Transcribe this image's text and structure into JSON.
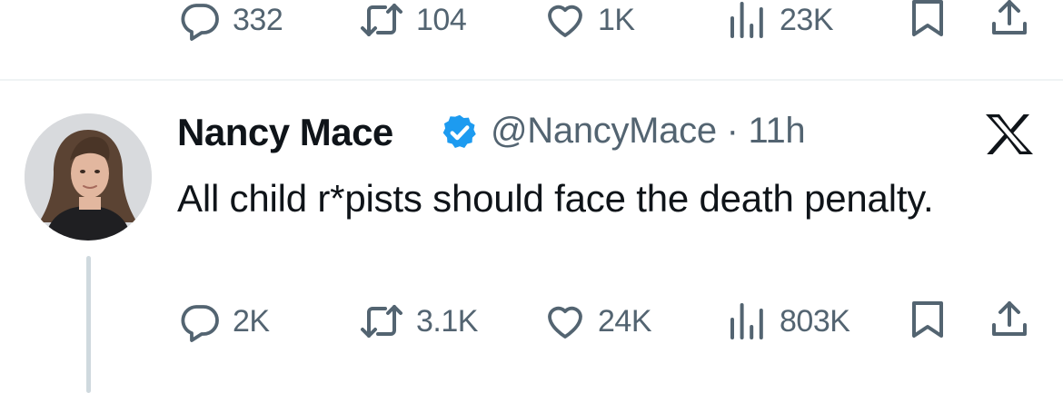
{
  "prev_tweet": {
    "replies": "332",
    "reposts": "104",
    "likes": "1K",
    "views": "23K"
  },
  "tweet": {
    "author_name": "Nancy Mace",
    "handle": "@NancyMace",
    "separator": "·",
    "time": "11h",
    "text": "All child r*pists should face the death penalty.",
    "replies": "2K",
    "reposts": "3.1K",
    "likes": "24K",
    "views": "803K"
  },
  "icons": [
    "reply-icon",
    "repost-icon",
    "like-icon",
    "views-icon",
    "bookmark-icon",
    "share-icon",
    "verified-badge-icon",
    "x-logo-icon"
  ],
  "colors": {
    "text": "#0f1419",
    "secondary": "#536471",
    "verified": "#1d9bf0",
    "divider": "#eff3f4",
    "thread_line": "#cfd9de"
  }
}
